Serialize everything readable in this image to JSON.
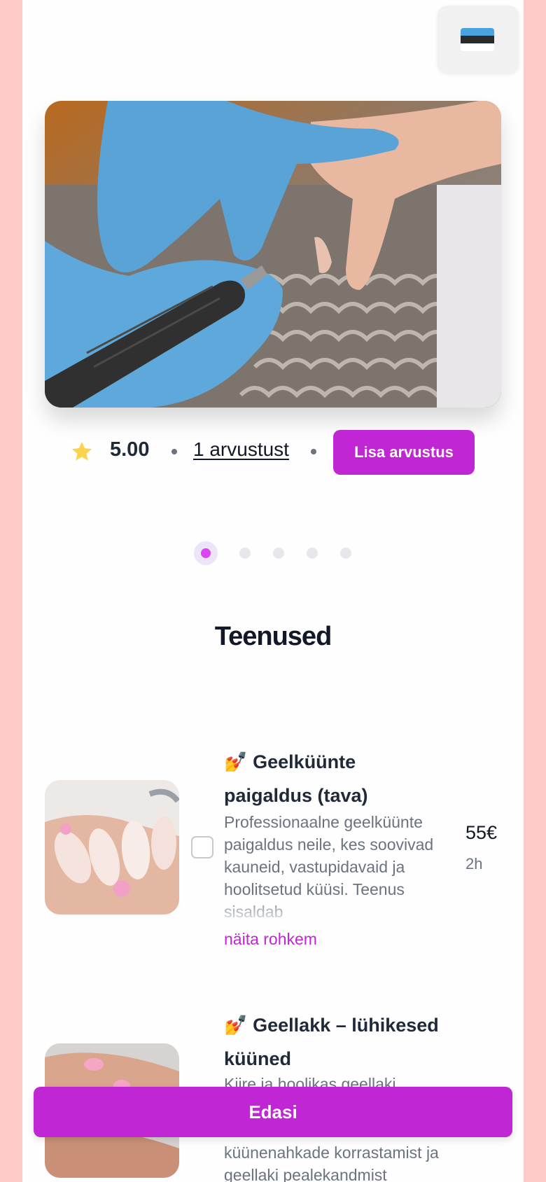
{
  "language": {
    "flag_icon": "estonian-flag-icon",
    "colors": [
      "#4aa3df",
      "#2b2b2b",
      "#ffffff"
    ]
  },
  "rating": {
    "score": "5.00",
    "reviews_link": "1 arvustust",
    "add_review_label": "Lisa arvustus",
    "star_icon": "star-icon"
  },
  "carousel": {
    "total": 5,
    "active": 1
  },
  "section_title": "Teenused",
  "services": [
    {
      "emoji": "💅",
      "title_line1": "Geelküünte",
      "title_line2": "paigaldus (tava)",
      "description": "Professionaalne geelküünte paigaldus neile, kes soovivad kauneid, vastupidavaid ja hoolitsetud küüsi. Teenus sisaldab",
      "show_more": "näita rohkem",
      "price": "55€",
      "duration": "2h"
    },
    {
      "emoji": "💅",
      "title_line1": "Geellakk – lühikesed",
      "title_line2": "küüned",
      "description_top": "Kiire ja hoolikas geellaki",
      "description_bottom": "küünenahkade korrastamist ja geellaki pealekandmist"
    }
  ],
  "next_button": "Edasi",
  "colors": {
    "accent": "#c026d3",
    "page_bg": "#fecaca"
  }
}
